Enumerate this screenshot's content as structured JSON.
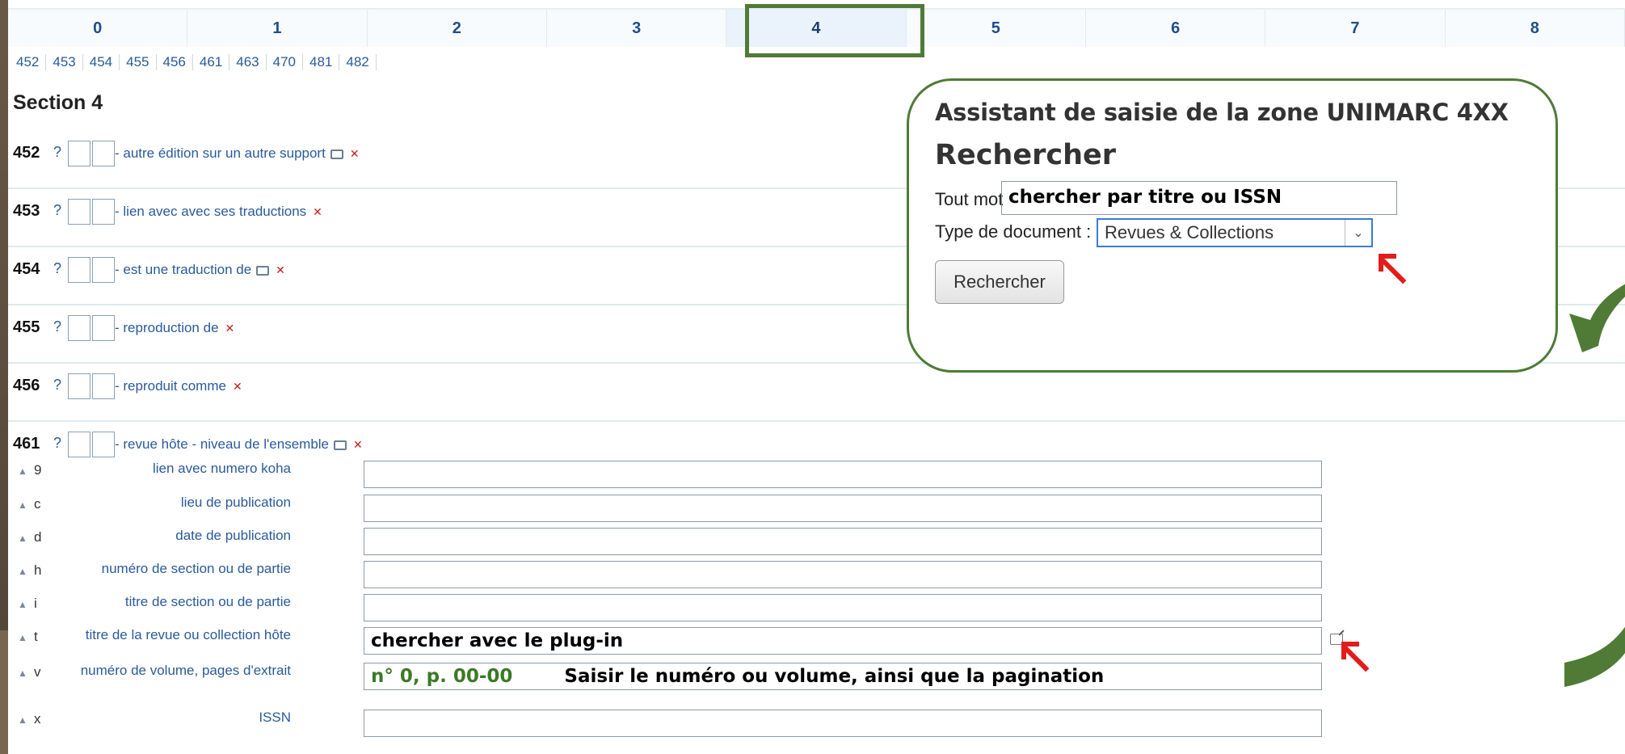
{
  "tabs": [
    "0",
    "1",
    "2",
    "3",
    "4",
    "5",
    "6",
    "7",
    "8"
  ],
  "active_tab": "4",
  "subnav": [
    "452",
    "453",
    "454",
    "455",
    "456",
    "461",
    "463",
    "470",
    "481",
    "482"
  ],
  "section_title": "Section 4",
  "fields": [
    {
      "tag": "452",
      "q": "?",
      "desc": "- autre édition sur un autre support",
      "dup": true
    },
    {
      "tag": "453",
      "q": "?",
      "desc": "- lien avec avec ses traductions",
      "dup": false
    },
    {
      "tag": "454",
      "q": "?",
      "desc": "- est une traduction de",
      "dup": true
    },
    {
      "tag": "455",
      "q": "?",
      "desc": "- reproduction de",
      "dup": false
    },
    {
      "tag": "456",
      "q": "?",
      "desc": "- reproduit comme",
      "dup": false
    },
    {
      "tag": "461",
      "q": "?",
      "desc": "- revue hôte - niveau de l'ensemble",
      "dup": true
    }
  ],
  "subfields": [
    {
      "code": "9",
      "label": "lien avec numero koha",
      "value": ""
    },
    {
      "code": "c",
      "label": "lieu de publication",
      "value": ""
    },
    {
      "code": "d",
      "label": "date de publication",
      "value": ""
    },
    {
      "code": "h",
      "label": "numéro de section ou de partie",
      "value": ""
    },
    {
      "code": "i",
      "label": "titre de section ou de partie",
      "value": ""
    },
    {
      "code": "t",
      "label": "titre de la revue ou collection hôte",
      "value": "chercher avec le plug-in"
    },
    {
      "code": "v",
      "label": "numéro de volume, pages d'extrait",
      "value_green": "n° 0, p. 00-00",
      "value": "Saisir le numéro ou volume, ainsi que la pagination"
    },
    {
      "code": "x",
      "label": "ISSN",
      "value": ""
    }
  ],
  "assistant": {
    "title": "Assistant de saisie de la zone UNIMARC 4XX",
    "heading": "Rechercher",
    "tout_mot_label": "Tout mot",
    "tout_mot_value": "chercher par titre ou ISSN",
    "type_label": "Type de document :",
    "type_value": "Revues & Collections",
    "button": "Rechercher"
  },
  "colors": {
    "frame_green": "#4f7b36",
    "arrow_red": "#e31b1b",
    "link_blue": "#2a5a9a"
  }
}
